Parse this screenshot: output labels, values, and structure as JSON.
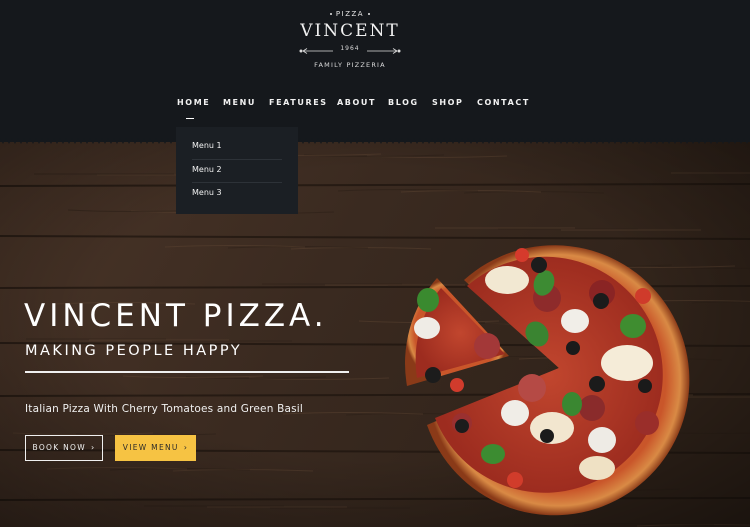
{
  "logo": {
    "top": "PIZZA",
    "name": "VINCENT",
    "year": "1964",
    "subtitle": "FAMILY PIZZERIA"
  },
  "nav": {
    "items": [
      {
        "label": "HOME",
        "active": true
      },
      {
        "label": "MENU"
      },
      {
        "label": "FEATURES"
      },
      {
        "label": "ABOUT"
      },
      {
        "label": "BLOG"
      },
      {
        "label": "SHOP"
      },
      {
        "label": "CONTACT"
      }
    ]
  },
  "dropdown": {
    "items": [
      "Menu 1",
      "Menu 2",
      "Menu 3"
    ]
  },
  "hero": {
    "title": "VINCENT PIZZA.",
    "subtitle": "MAKING PEOPLE HAPPY",
    "description": "Italian Pizza With Cherry Tomatoes and Green Basil",
    "book_button": "BOOK NOW",
    "menu_button": "VIEW MENU",
    "chevron_icon": "chevron-right-icon"
  },
  "colors": {
    "header_bg": "#15181c",
    "dropdown_bg": "#1b1f24",
    "accent_yellow": "#f6c343",
    "wood_dark": "#3b2a21",
    "text": "#ffffff"
  }
}
